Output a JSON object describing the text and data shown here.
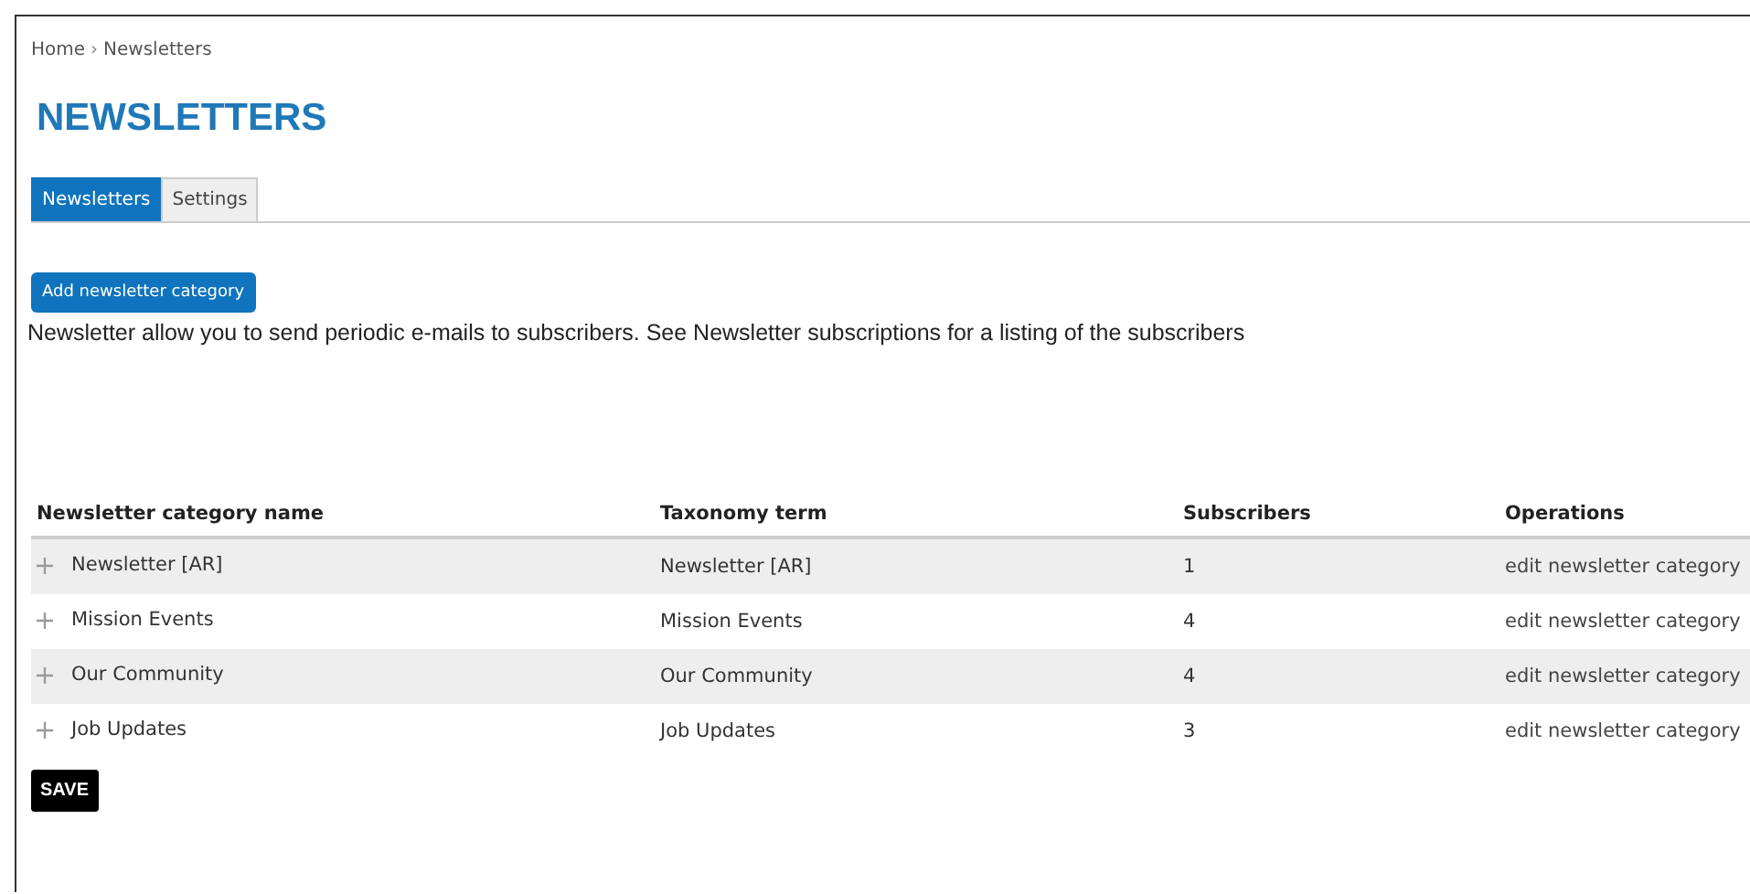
{
  "breadcrumb": [
    "Home",
    "Newsletters"
  ],
  "breadcrumb_separator": "›",
  "title": "NEWSLETTERS",
  "tabs": [
    {
      "label": "Newsletters",
      "selected": true
    },
    {
      "label": "Settings",
      "selected": false
    }
  ],
  "add_button": "Add newsletter category",
  "description": "Newsletter allow you to send periodic e-mails to subscribers. See Newsletter subscriptions for a listing of the subscribers",
  "table": {
    "columns": [
      "Newsletter category name",
      "Taxonomy term",
      "Subscribers",
      "Operations"
    ],
    "rows": [
      {
        "name": "Newsletter [AR]",
        "term": "Newsletter [AR]",
        "subscribers": "1",
        "operation": "edit newsletter category"
      },
      {
        "name": "Mission Events",
        "term": "Mission Events",
        "subscribers": "4",
        "operation": "edit newsletter category"
      },
      {
        "name": "Our Community",
        "term": "Our Community",
        "subscribers": "4",
        "operation": "edit newsletter category"
      },
      {
        "name": "Job Updates",
        "term": "Job Updates",
        "subscribers": "3",
        "operation": "edit newsletter category"
      }
    ]
  },
  "save_button": "SAVE"
}
